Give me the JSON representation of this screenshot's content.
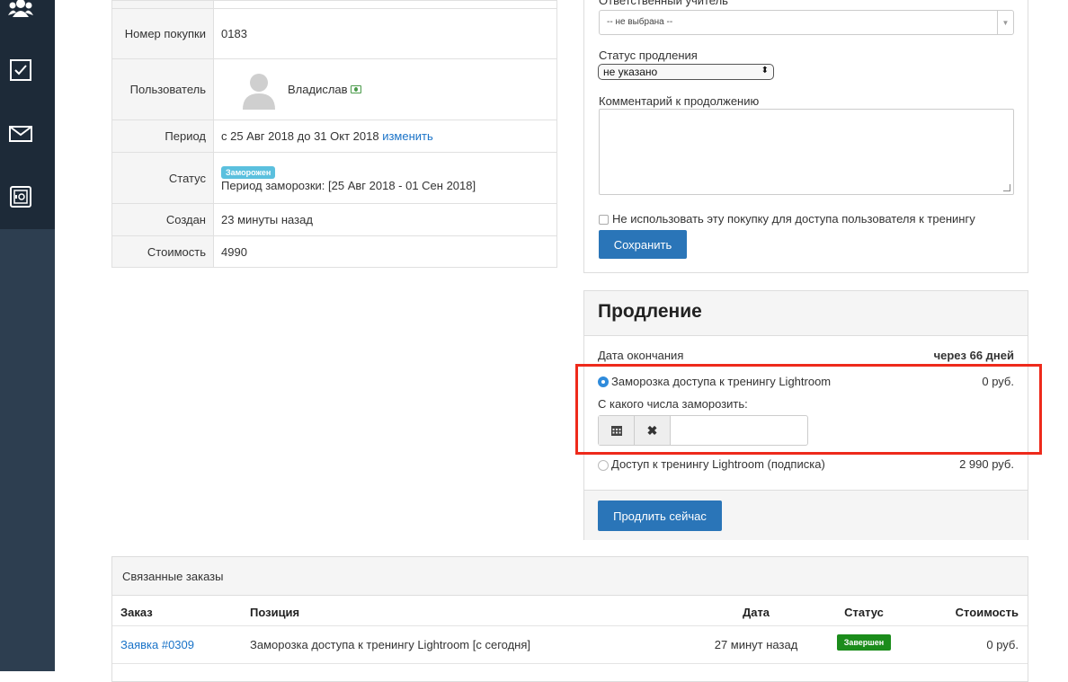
{
  "details": {
    "purchase_number_label": "Номер покупки",
    "purchase_number": "0183",
    "user_label": "Пользователь",
    "user_name": "Владислав",
    "period_label": "Период",
    "period_value": "с 25 Авг 2018 до 31 Окт 2018",
    "period_change": "изменить",
    "status_label": "Статус",
    "status_badge": "Заморожен",
    "freeze_period": "Период заморозки: [25 Авг 2018 - 01 Сен 2018]",
    "created_label": "Создан",
    "created_value": "23 минуты назад",
    "cost_label": "Стоимость",
    "cost_value": "4990"
  },
  "form": {
    "teacher_label": "Ответственный учитель",
    "teacher_value": "-- не выбрана --",
    "renewal_status_label": "Статус продления",
    "renewal_status_value": "не указано",
    "comment_label": "Комментарий к продолжению",
    "no_access_label": "Не использовать эту покупку для доступа пользователя к тренингу",
    "save_button": "Сохранить"
  },
  "renewal": {
    "title": "Продление",
    "end_date_label": "Дата окончания",
    "end_date_value": "через 66 дней",
    "option1_label": "Заморозка доступа к тренингу Lightroom",
    "option1_price": "0 руб.",
    "option1_selected": true,
    "freeze_from_label": "С какого числа заморозить:",
    "option2_label": "Доступ к тренингу Lightroom (подписка)",
    "option2_price": "2 990 руб.",
    "renew_button": "Продлить сейчас"
  },
  "orders": {
    "title": "Связанные заказы",
    "headers": {
      "order": "Заказ",
      "position": "Позиция",
      "date": "Дата",
      "status": "Статус",
      "cost": "Стоимость"
    },
    "rows": [
      {
        "order": "Заявка #0309",
        "position": "Заморозка доступа к тренингу Lightroom [с сегодня]",
        "date": "27 минут назад",
        "status": "Завершен",
        "cost": "0 руб."
      }
    ]
  },
  "colors": {
    "sidebar": "#2d3e50",
    "primary_button": "#2a75b8",
    "link": "#1a73c8",
    "frozen_badge": "#5bc0de",
    "done_badge": "#1b8c1b",
    "highlight": "#ee2a1b"
  },
  "icons": [
    "users-icon",
    "checkbox-icon",
    "mail-icon",
    "safe-icon",
    "calendar-icon",
    "clear-icon",
    "money-icon",
    "avatar-placeholder"
  ]
}
